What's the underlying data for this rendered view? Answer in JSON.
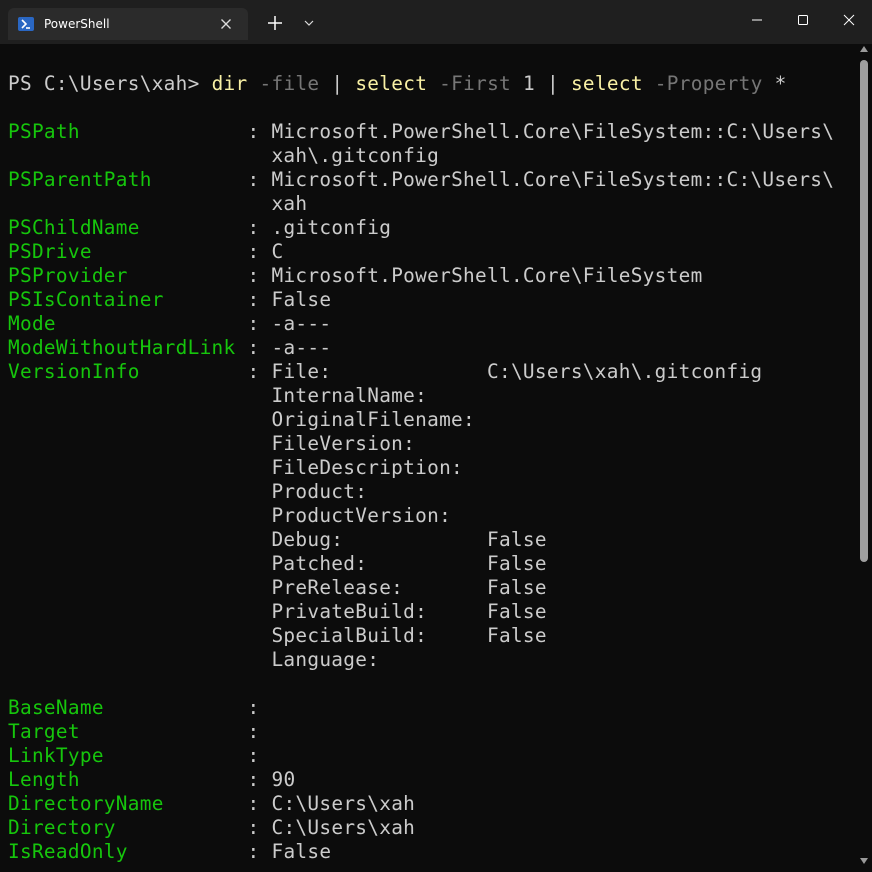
{
  "window": {
    "tab_title": "PowerShell",
    "tab_icon": "powershell-icon",
    "controls": [
      "new-tab-icon",
      "chevron-down-icon",
      "minimize-icon",
      "maximize-icon",
      "close-icon"
    ]
  },
  "colors": {
    "background": "#0c0c0c",
    "foreground": "#cccccc",
    "command": "#f9f1a5",
    "parameter": "#767676",
    "property_name": "#16c60c"
  },
  "prompt": {
    "path": "PS C:\\Users\\xah>",
    "tokens": [
      {
        "text": "dir",
        "kind": "cmd"
      },
      {
        "text": "-file",
        "kind": "param"
      },
      {
        "text": "|",
        "kind": "op"
      },
      {
        "text": "select",
        "kind": "cmd"
      },
      {
        "text": "-First",
        "kind": "param"
      },
      {
        "text": "1",
        "kind": "num"
      },
      {
        "text": "|",
        "kind": "op"
      },
      {
        "text": "select",
        "kind": "cmd"
      },
      {
        "text": "-Property",
        "kind": "param"
      },
      {
        "text": "*",
        "kind": "op"
      }
    ]
  },
  "output": {
    "separator": ":",
    "properties": [
      {
        "name": "PSPath",
        "lines": [
          "Microsoft.PowerShell.Core\\FileSystem::C:\\Users\\",
          "xah\\.gitconfig"
        ]
      },
      {
        "name": "PSParentPath",
        "lines": [
          "Microsoft.PowerShell.Core\\FileSystem::C:\\Users\\",
          "xah"
        ]
      },
      {
        "name": "PSChildName",
        "lines": [
          ".gitconfig"
        ]
      },
      {
        "name": "PSDrive",
        "lines": [
          "C"
        ]
      },
      {
        "name": "PSProvider",
        "lines": [
          "Microsoft.PowerShell.Core\\FileSystem"
        ]
      },
      {
        "name": "PSIsContainer",
        "lines": [
          "False"
        ]
      },
      {
        "name": "Mode",
        "lines": [
          "-a---"
        ]
      },
      {
        "name": "ModeWithoutHardLink",
        "lines": [
          "-a---"
        ]
      },
      {
        "name": "VersionInfo",
        "lines": [
          "File:             C:\\Users\\xah\\.gitconfig",
          "InternalName:",
          "OriginalFilename:",
          "FileVersion:",
          "FileDescription:",
          "Product:",
          "ProductVersion:",
          "Debug:            False",
          "Patched:          False",
          "PreRelease:       False",
          "PrivateBuild:     False",
          "SpecialBuild:     False",
          "Language:",
          ""
        ]
      },
      {
        "name": "BaseName",
        "lines": [
          ""
        ]
      },
      {
        "name": "Target",
        "lines": [
          ""
        ]
      },
      {
        "name": "LinkType",
        "lines": [
          ""
        ]
      },
      {
        "name": "Length",
        "lines": [
          "90"
        ]
      },
      {
        "name": "DirectoryName",
        "lines": [
          "C:\\Users\\xah"
        ]
      },
      {
        "name": "Directory",
        "lines": [
          "C:\\Users\\xah"
        ]
      },
      {
        "name": "IsReadOnly",
        "lines": [
          "False"
        ]
      }
    ]
  }
}
